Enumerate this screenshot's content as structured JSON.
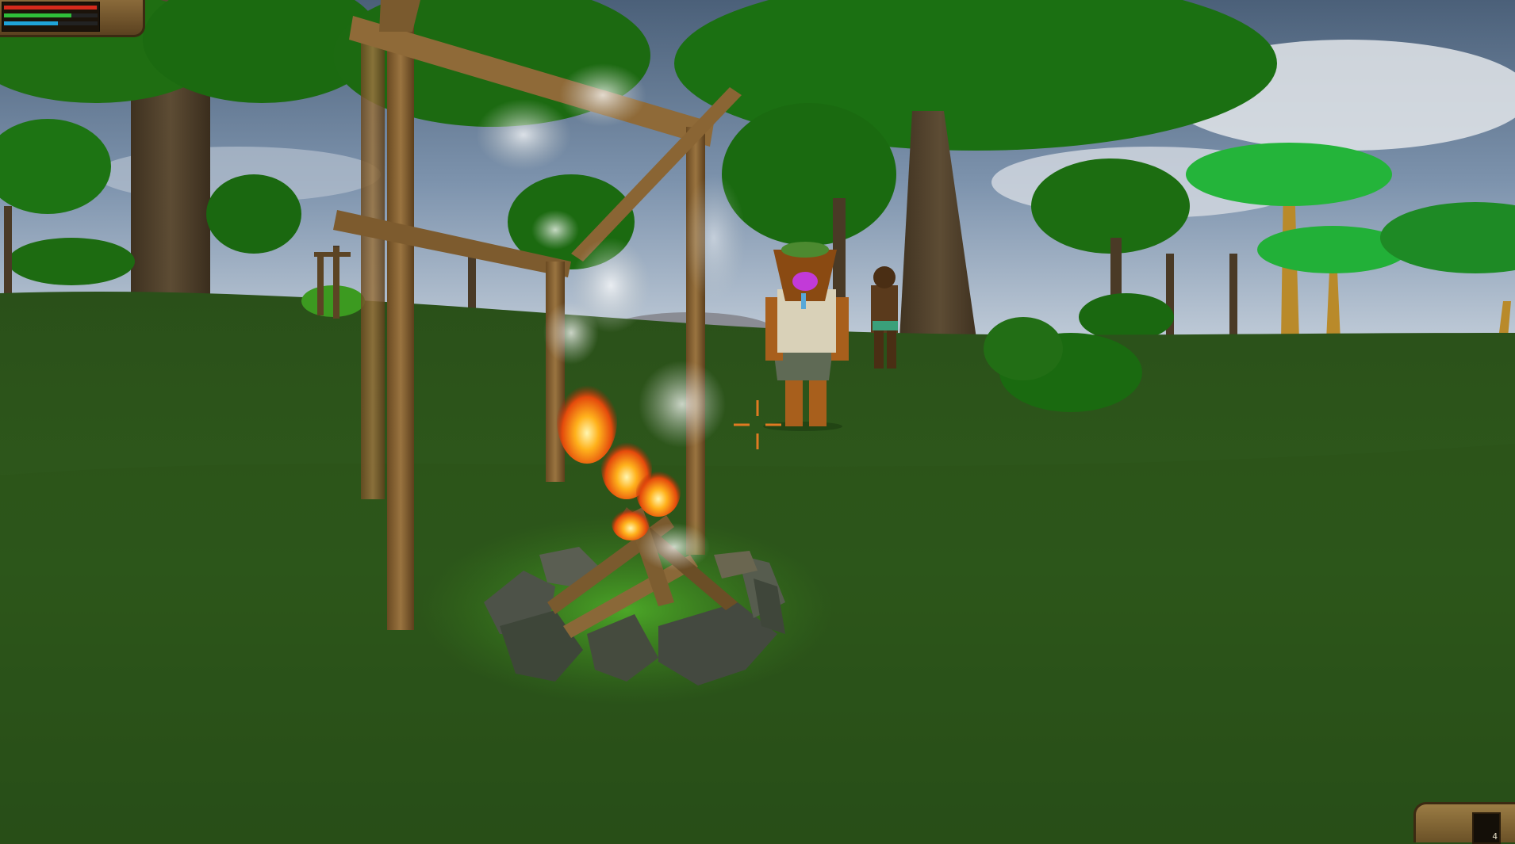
{
  "hud": {
    "health": 0.99,
    "stamina": 0.72,
    "water": 0.58,
    "colors": {
      "health": "#d62a1c",
      "stamina": "#2fbf3a",
      "water": "#1fa4d8"
    }
  },
  "hotbar": {
    "slot_count": "4"
  },
  "scene": {
    "objects": [
      "campfire",
      "wooden-frame",
      "tribal-npc-masked",
      "tribal-npc-distant",
      "jungle-trees",
      "palm-trees",
      "smoke",
      "crosshair"
    ]
  }
}
